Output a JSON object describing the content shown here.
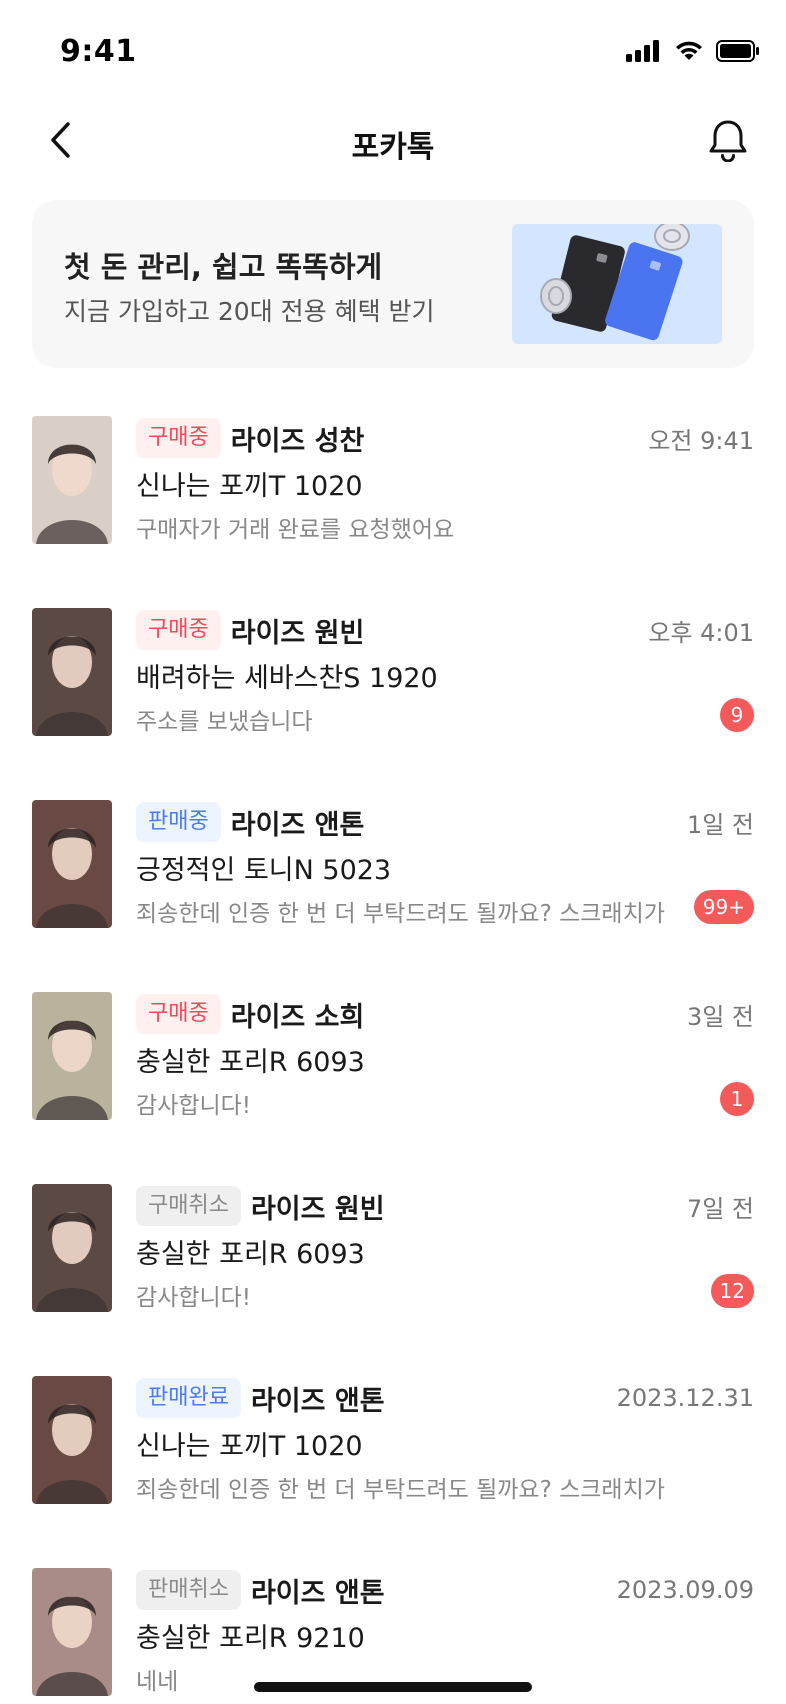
{
  "status_bar": {
    "time": "9:41"
  },
  "nav": {
    "title": "포카톡"
  },
  "banner": {
    "title": "첫 돈 관리, 쉽고 똑똑하게",
    "subtitle": "지금 가입하고 20대 전용 혜택 받기"
  },
  "chats": [
    {
      "tag": "구매중",
      "tag_type": "buy",
      "partner": "라이즈 성찬",
      "time": "오전 9:41",
      "product": "신나는 포끼T 1020",
      "message": "구매자가 거래 완료를 요청했어요",
      "badge": "",
      "thumb_color": "#d9cfc6"
    },
    {
      "tag": "구매중",
      "tag_type": "buy",
      "partner": "라이즈 원빈",
      "time": "오후 4:01",
      "product": "배려하는 세바스찬S 1920",
      "message": "주소를 보냈습니다",
      "badge": "9",
      "thumb_color": "#5b4a44"
    },
    {
      "tag": "판매중",
      "tag_type": "sell",
      "partner": "라이즈 앤톤",
      "time": "1일 전",
      "product": "긍정적인 토니N 5023",
      "message": "죄송한데 인증 한 번 더 부탁드려도 될까요? 스크래치가",
      "badge": "99+",
      "thumb_color": "#6a4a44"
    },
    {
      "tag": "구매중",
      "tag_type": "buy",
      "partner": "라이즈 소희",
      "time": "3일 전",
      "product": "충실한 포리R 6093",
      "message": "감사합니다!",
      "badge": "1",
      "thumb_color": "#b9b39d"
    },
    {
      "tag": "구매취소",
      "tag_type": "cancel",
      "partner": "라이즈 원빈",
      "time": "7일 전",
      "product": "충실한 포리R 6093",
      "message": "감사합니다!",
      "badge": "12",
      "thumb_color": "#5b4a44"
    },
    {
      "tag": "판매완료",
      "tag_type": "done",
      "partner": "라이즈 앤톤",
      "time": "2023.12.31",
      "product": "신나는 포끼T 1020",
      "message": "죄송한데 인증 한 번 더 부탁드려도 될까요? 스크래치가",
      "badge": "",
      "thumb_color": "#6a4a44"
    },
    {
      "tag": "판매취소",
      "tag_type": "cancel",
      "partner": "라이즈 앤톤",
      "time": "2023.09.09",
      "product": "충실한 포리R 9210",
      "message": "네네",
      "badge": "",
      "thumb_color": "#a98c88"
    }
  ]
}
